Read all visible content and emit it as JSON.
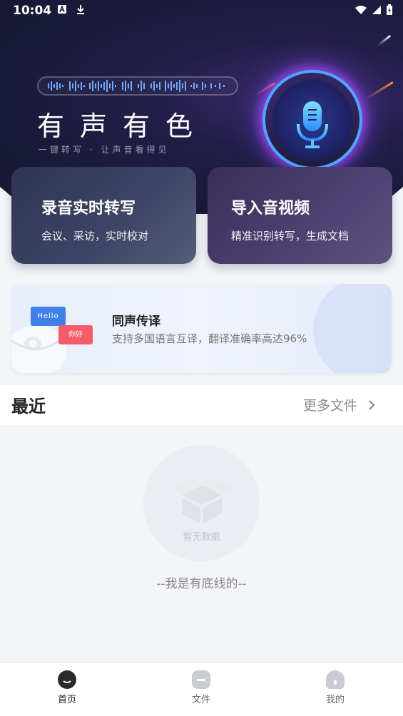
{
  "status": {
    "time": "10:04"
  },
  "hero": {
    "title": "有声有色",
    "subtitle": "一键转写 · 让声音看得见"
  },
  "cards": [
    {
      "title": "录音实时转写",
      "subtitle": "会议、采访，实时校对"
    },
    {
      "title": "导入音视频",
      "subtitle": "精准识别转写，生成文档"
    }
  ],
  "banner": {
    "title": "同声传译",
    "subtitle": "支持多国语言互译，翻译准确率高达96%",
    "bubble_en": "Hello",
    "bubble_zh": "你好"
  },
  "recent": {
    "title": "最近",
    "more_label": "更多文件",
    "empty_text": "暂无数据",
    "bottom_line": "--我是有底线的--"
  },
  "tabs": [
    {
      "label": "首页",
      "active": true
    },
    {
      "label": "文件",
      "active": false
    },
    {
      "label": "我的",
      "active": false
    }
  ],
  "colors": {
    "accent_blue": "#3f7fe8",
    "accent_red": "#f25c6b",
    "hero_bg": "#1a1a3a"
  }
}
